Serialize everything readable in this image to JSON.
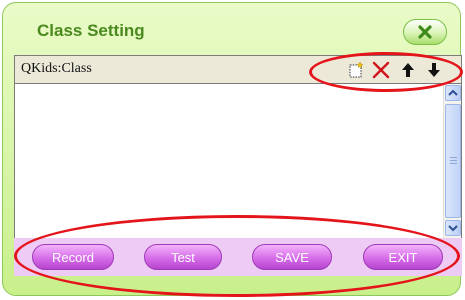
{
  "window": {
    "title": "Class Setting"
  },
  "list": {
    "header_label": "QKids:Class",
    "tools": [
      "new-icon",
      "delete-icon",
      "move-up-icon",
      "move-down-icon"
    ]
  },
  "buttons": {
    "record": "Record",
    "test": "Test",
    "save": "SAVE",
    "exit": "EXIT"
  },
  "colors": {
    "title": "#4a8a1e",
    "button": "#d66de8",
    "highlight": "#e4141b"
  }
}
